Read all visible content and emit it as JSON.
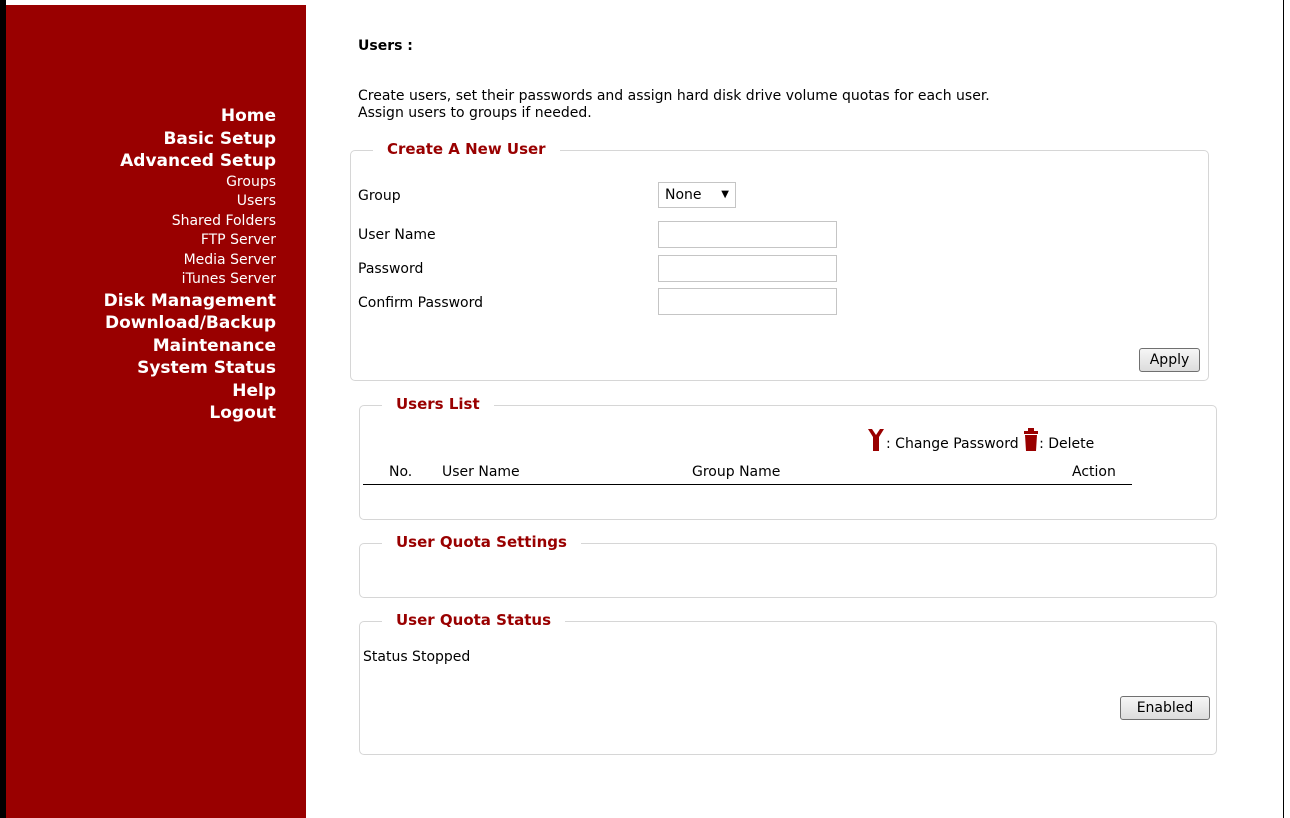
{
  "nav": {
    "home": "Home",
    "basic_setup": "Basic Setup",
    "advanced_setup": "Advanced Setup",
    "sub": {
      "groups": "Groups",
      "users": "Users",
      "shared_folders": "Shared Folders",
      "ftp_server": "FTP Server",
      "media_server": "Media Server",
      "itunes_server": "iTunes Server"
    },
    "disk_management": "Disk Management",
    "download_backup": "Download/Backup",
    "maintenance": "Maintenance",
    "system_status": "System Status",
    "help": "Help",
    "logout": "Logout"
  },
  "page": {
    "title": "Users :",
    "description_1": "Create users, set their passwords and assign hard disk drive volume quotas for each user.",
    "description_2": "Assign users to groups if needed."
  },
  "create_user": {
    "legend": "Create A New User",
    "group_label": "Group",
    "group_value": "None",
    "username_label": "User Name",
    "username_value": "",
    "password_label": "Password",
    "password_value": "",
    "confirm_label": "Confirm Password",
    "confirm_value": "",
    "apply_label": "Apply"
  },
  "users_list": {
    "legend": "Users List",
    "change_password_text": ": Change Password",
    "delete_text": ": Delete",
    "columns": [
      "No.",
      "User Name",
      "Group Name",
      "Action"
    ]
  },
  "quota_settings": {
    "legend": "User Quota Settings"
  },
  "quota_status": {
    "legend": "User Quota Status",
    "status_text": "Status Stopped",
    "enabled_label": "Enabled"
  },
  "colors": {
    "sidebar": "#990000",
    "legend": "#990000",
    "icon": "#990000"
  }
}
